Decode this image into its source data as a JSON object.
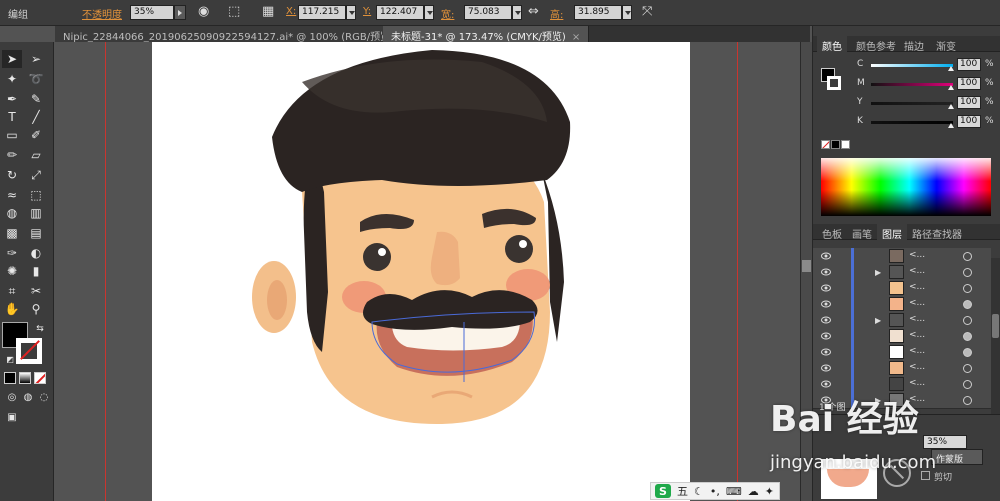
{
  "control_bar": {
    "mode_label": "编组",
    "opacity_label": "不透明度",
    "opacity_value": "35%",
    "x_label": "X:",
    "x_value": "117.215",
    "y_label": "Y:",
    "y_value": "122.407",
    "width_label": "宽:",
    "width_value": "75.083",
    "height_label": "高:",
    "height_value": "31.895"
  },
  "doc_tabs": [
    {
      "label": "Nipic_22844066_20190625090922594127.ai* @ 100% (RGB/预览)",
      "close": "×",
      "active": false
    },
    {
      "label": "未标题-31* @ 173.47% (CMYK/预览)",
      "close": "×",
      "active": true
    }
  ],
  "color_panel": {
    "tabs": [
      "颜色",
      "颜色参考",
      "描边",
      "渐变"
    ],
    "channels": [
      {
        "name": "C",
        "value": "100",
        "unit": "%"
      },
      {
        "name": "M",
        "value": "100",
        "unit": "%"
      },
      {
        "name": "Y",
        "value": "100",
        "unit": "%"
      },
      {
        "name": "K",
        "value": "100",
        "unit": "%"
      }
    ]
  },
  "layers_panel": {
    "tabs": [
      "色板",
      "画笔",
      "图层",
      "路径查找器"
    ],
    "rows": [
      {
        "name": "<...",
        "expand": false,
        "thumb_color": "#7a6a60",
        "target_filled": false
      },
      {
        "name": "<...",
        "expand": true,
        "thumb_color": "#555555",
        "target_filled": false
      },
      {
        "name": "<...",
        "expand": false,
        "thumb_color": "#f3c28e",
        "target_filled": false
      },
      {
        "name": "<...",
        "expand": false,
        "thumb_color": "#f3b38a",
        "target_filled": true
      },
      {
        "name": "<...",
        "expand": true,
        "thumb_color": "#555555",
        "target_filled": false
      },
      {
        "name": "<...",
        "expand": false,
        "thumb_color": "#f0e0d0",
        "target_filled": true
      },
      {
        "name": "<...",
        "expand": false,
        "thumb_color": "#ffffff",
        "target_filled": true
      },
      {
        "name": "<...",
        "expand": false,
        "thumb_color": "#f1b98b",
        "target_filled": false
      },
      {
        "name": "<...",
        "expand": false,
        "thumb_color": "#444444",
        "target_filled": false
      },
      {
        "name": "<...",
        "expand": true,
        "thumb_color": "#777777",
        "target_filled": false
      }
    ],
    "layer_count": "1 个图"
  },
  "transparency_panel": {
    "opacity_value": "35%",
    "make_mask_label": "作蒙版",
    "clip_label": "剪切"
  },
  "watermark": {
    "brand": "Bai  经验",
    "url": "jingyan.baidu.com"
  },
  "ime": {
    "badge": "S",
    "mode": "五"
  },
  "colors": {
    "hair": "#2b2422",
    "skin": "#f6c48e",
    "cheek": "#f09a78",
    "guide": "#c9352f",
    "layer_highlight": "#4b6fd6"
  }
}
